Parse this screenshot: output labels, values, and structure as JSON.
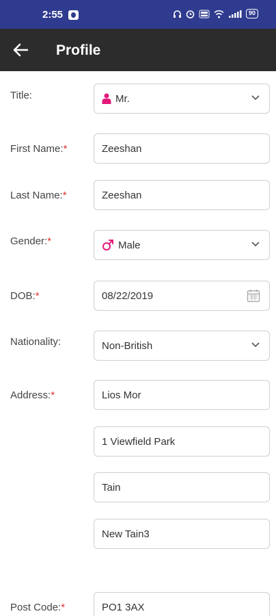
{
  "status_bar": {
    "time": "2:55",
    "battery": "90"
  },
  "app_bar": {
    "title": "Profile"
  },
  "colors": {
    "status_bar": "#2f3b8f",
    "app_bar": "#2c2c2c",
    "required_marker": "#e0302d",
    "accent_pink": "#e3197b"
  },
  "required_marker": "*",
  "form": {
    "title": {
      "label": "Title:",
      "value": "Mr.",
      "icon": "person-icon"
    },
    "first_name": {
      "label": "First Name:",
      "value": "Zeeshan"
    },
    "last_name": {
      "label": "Last Name:",
      "value": "Zeeshan"
    },
    "gender": {
      "label": "Gender:",
      "value": "Male",
      "icon": "male-icon"
    },
    "dob": {
      "label": "DOB:",
      "value": "08/22/2019",
      "icon": "calendar-icon"
    },
    "nationality": {
      "label": "Nationality:",
      "value": "Non-British"
    },
    "address": {
      "label": "Address:",
      "line1": "Lios Mor",
      "line2": "1 Viewfield Park",
      "line3": "Tain",
      "line4": "New Tain3"
    },
    "post_code": {
      "label": "Post Code:",
      "value": "PO1 3AX"
    }
  }
}
